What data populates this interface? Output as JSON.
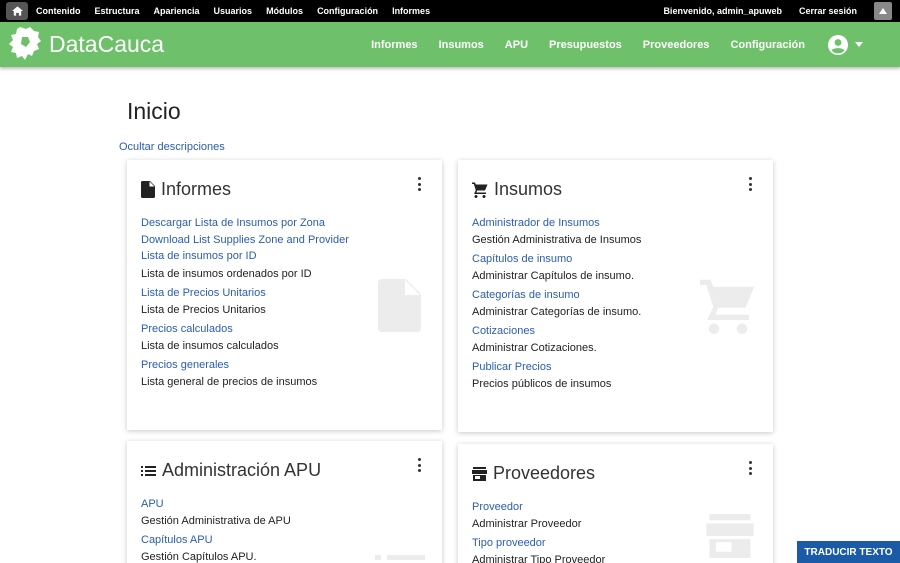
{
  "admin_bar": {
    "menu": [
      "Contenido",
      "Estructura",
      "Apariencia",
      "Usuarios",
      "Módulos",
      "Configuración",
      "Informes"
    ],
    "welcome": "Bienvenido, admin_apuweb",
    "logout": "Cerrar sesión"
  },
  "header": {
    "brand": "DataCauca",
    "nav": [
      "Informes",
      "Insumos",
      "APU",
      "Presupuestos",
      "Proveedores",
      "Configuración"
    ],
    "color": "#6ec16a"
  },
  "page": {
    "title": "Inicio",
    "toggle_descriptions": "Ocultar descripciones"
  },
  "cards": {
    "informes": {
      "title": "Informes",
      "icon": "document-icon",
      "items": [
        {
          "link": "Descargar Lista de Insumos por Zona"
        },
        {
          "link": "Download List Supplies Zone and Provider"
        },
        {
          "link": "Lista de insumos por ID",
          "desc": "Lista de insumos ordenados por ID"
        },
        {
          "link": "Lista de Precios Unitarios",
          "desc": "Lista de Precios Unitarios"
        },
        {
          "link": "Precios calculados",
          "desc": "Lista de insumos calculados"
        },
        {
          "link": "Precios generales",
          "desc": "Lista general de precios de insumos"
        }
      ]
    },
    "insumos": {
      "title": "Insumos",
      "icon": "cart-icon",
      "items": [
        {
          "link": "Administrador de Insumos",
          "desc": "Gestión Administrativa de Insumos"
        },
        {
          "link": "Capítulos de insumo",
          "desc": "Administrar Capítulos de insumo."
        },
        {
          "link": "Categorías de insumo",
          "desc": "Administrar Categorías de insumo."
        },
        {
          "link": "Cotizaciones",
          "desc": "Administrar Cotizaciones."
        },
        {
          "link": "Publicar Precios",
          "desc": "Precios públicos de insumos"
        }
      ]
    },
    "apu": {
      "title": "Administración APU",
      "icon": "list-icon",
      "items": [
        {
          "link": "APU",
          "desc": "Gestión Administrativa de APU"
        },
        {
          "link": "Capítulos APU",
          "desc": "Gestión Capítulos APU."
        }
      ]
    },
    "proveedores": {
      "title": "Proveedores",
      "icon": "store-icon",
      "items": [
        {
          "link": "Proveedor",
          "desc": "Administrar Proveedor"
        },
        {
          "link": "Tipo proveedor",
          "desc": "Administrar Tipo Proveedor"
        }
      ]
    }
  },
  "translate": "TRADUCIR TEXTO"
}
